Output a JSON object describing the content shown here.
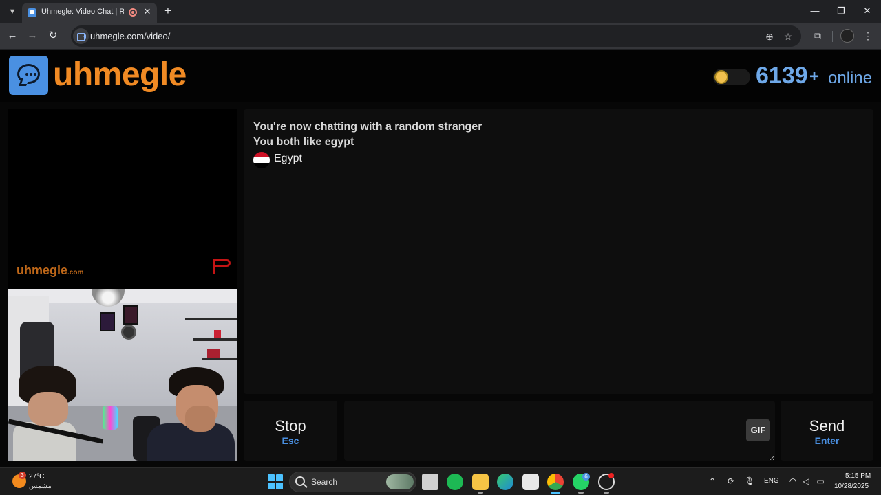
{
  "browser": {
    "tab_title": "Uhmegle: Video Chat | Random",
    "tab_list_icon": "chevron-down-icon",
    "new_tab_label": "+",
    "url": "uhmegle.com/video/",
    "window_controls": {
      "minimize": "—",
      "maximize": "❐",
      "close": "✕"
    },
    "tab_close": "✕"
  },
  "header": {
    "logo_text": "uhmegle",
    "online_count": "6139",
    "online_plus": "+",
    "online_label": "online",
    "theme_toggle_icon": "sun-icon"
  },
  "stranger_video": {
    "watermark": "uhmegle",
    "watermark_suffix": ".com",
    "report_icon": "flag-icon"
  },
  "chat": {
    "lines": [
      "You're now chatting with a random stranger",
      "You both like egypt"
    ],
    "country": "Egypt",
    "flag_colors": [
      "#ce1126",
      "#ffffff",
      "#000000"
    ]
  },
  "controls": {
    "stop_label": "Stop",
    "stop_key": "Esc",
    "message_value": "",
    "gif_label": "GIF",
    "send_label": "Send",
    "send_key": "Enter"
  },
  "taskbar": {
    "weather_temp": "27°C",
    "weather_desc": "مشمس",
    "weather_badge": "3",
    "search_label": "Search",
    "whatsapp_badge": "6",
    "language": "ENG",
    "time": "5:15 PM",
    "date": "10/28/2025"
  },
  "colors": {
    "accent_blue": "#4a90e2",
    "brand_orange": "#f08a24",
    "online_blue": "#6ea8e8",
    "report_red": "#c41414"
  }
}
